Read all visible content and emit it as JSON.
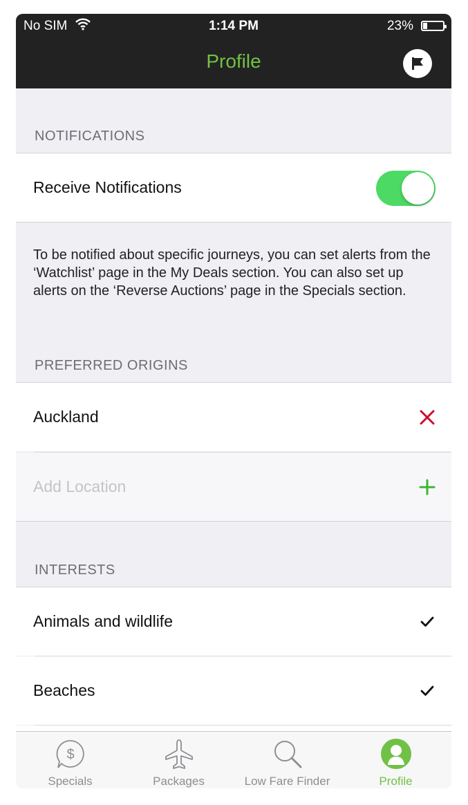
{
  "status_bar": {
    "carrier": "No SIM",
    "time": "1:14 PM",
    "battery": "23%",
    "battery_level": 0.23
  },
  "nav": {
    "title": "Profile",
    "right_icon": "flag-icon"
  },
  "notifications": {
    "header": "NOTIFICATIONS",
    "receive_label": "Receive Notifications",
    "receive_on": true,
    "info": "To be notified about specific journeys, you can set alerts from the ‘Watchlist’ page in the My Deals section. You can also set up alerts on the ‘Reverse Auctions’ page in the Specials section."
  },
  "origins": {
    "header": "PREFERRED ORIGINS",
    "items": [
      {
        "label": "Auckland",
        "action_icon": "remove-icon"
      }
    ],
    "add_placeholder": "Add Location"
  },
  "interests": {
    "header": "INTERESTS",
    "items": [
      {
        "label": "Animals and wildlife",
        "checked": true
      },
      {
        "label": "Beaches",
        "checked": true
      }
    ]
  },
  "tabs": [
    {
      "label": "Specials",
      "icon": "dollar-bubble-icon",
      "active": false
    },
    {
      "label": "Packages",
      "icon": "airplane-icon",
      "active": false
    },
    {
      "label": "Low Fare Finder",
      "icon": "magnifier-icon",
      "active": false
    },
    {
      "label": "Profile",
      "icon": "profile-icon",
      "active": true
    }
  ],
  "colors": {
    "accent": "#71c146",
    "toggle_on": "#4cd964",
    "remove": "#c8102e",
    "add": "#3db534",
    "nav_bg": "#222222"
  }
}
